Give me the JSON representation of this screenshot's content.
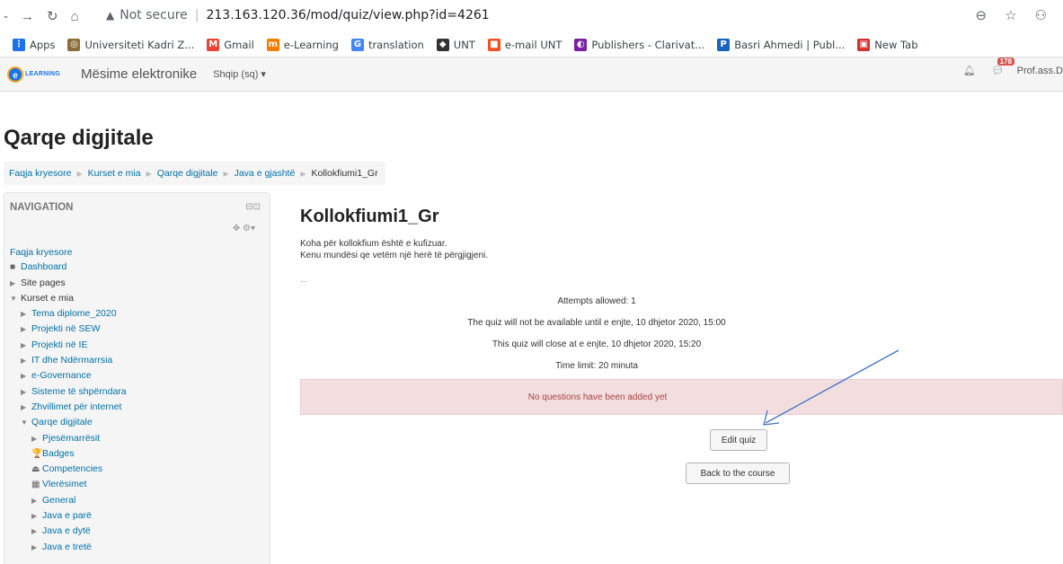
{
  "browser": {
    "security_text": "Not secure",
    "url": "213.163.120.36/mod/quiz/view.php?id=4261"
  },
  "bookmarks": [
    {
      "label": "Apps",
      "color": "#1a73e8",
      "glyph": "⋮"
    },
    {
      "label": "Universiteti Kadri Z...",
      "color": "#8a6d3b",
      "glyph": "◎"
    },
    {
      "label": "Gmail",
      "color": "#ea4335",
      "glyph": "M"
    },
    {
      "label": "e-Learning",
      "color": "#f57c00",
      "glyph": "m"
    },
    {
      "label": "translation",
      "color": "#4285f4",
      "glyph": "G"
    },
    {
      "label": "UNT",
      "color": "#333333",
      "glyph": "◆"
    },
    {
      "label": "e-mail UNT",
      "color": "#f25022",
      "glyph": "■"
    },
    {
      "label": "Publishers - Clarivat...",
      "color": "#7b1fa2",
      "glyph": "◐"
    },
    {
      "label": "Basri Ahmedi | Publ...",
      "color": "#1565c0",
      "glyph": "P"
    },
    {
      "label": "New Tab",
      "color": "#d32f2f",
      "glyph": "▣"
    }
  ],
  "navbar": {
    "logo_text": "LEARNING",
    "brand": "Mësime elektronike",
    "language": "Shqip (sq) ▾",
    "messages_count": "178",
    "user": "Prof.ass.D"
  },
  "page": {
    "heading": "Qarqe digjitale",
    "breadcrumb": [
      "Faqja kryesore",
      "Kurset e mia",
      "Qarqe digjitale",
      "Java e gjashtë",
      "Kollokfiumi1_Gr"
    ]
  },
  "sidebar": {
    "title": "NAVIGATION",
    "items": [
      {
        "label": "Faqja kryesore",
        "type": "link",
        "indent": 0,
        "marker": ""
      },
      {
        "label": "Dashboard",
        "type": "link",
        "indent": 0,
        "marker": "■"
      },
      {
        "label": "Site pages",
        "type": "plain",
        "indent": 0,
        "marker": "▶"
      },
      {
        "label": "Kurset e mia",
        "type": "plain",
        "indent": 0,
        "marker": "▼"
      },
      {
        "label": "Tema diplome_2020",
        "type": "link",
        "indent": 1,
        "marker": "▶"
      },
      {
        "label": "Projekti në SEW",
        "type": "link",
        "indent": 1,
        "marker": "▶"
      },
      {
        "label": "Projekti në IE",
        "type": "link",
        "indent": 1,
        "marker": "▶"
      },
      {
        "label": "IT dhe Ndërmarrsia",
        "type": "link",
        "indent": 1,
        "marker": "▶"
      },
      {
        "label": "e-Governance",
        "type": "link",
        "indent": 1,
        "marker": "▶"
      },
      {
        "label": "Sisteme të shpërndara",
        "type": "link",
        "indent": 1,
        "marker": "▶"
      },
      {
        "label": "Zhvillimet për internet",
        "type": "link",
        "indent": 1,
        "marker": "▶"
      },
      {
        "label": "Qarqe digjitale",
        "type": "link",
        "indent": 1,
        "marker": "▼"
      },
      {
        "label": "Pjesëmarrësit",
        "type": "link",
        "indent": 2,
        "marker": "▶"
      },
      {
        "label": "Badges",
        "type": "link",
        "indent": 2,
        "marker": "🏆"
      },
      {
        "label": "Competencies",
        "type": "link",
        "indent": 2,
        "marker": "⏏"
      },
      {
        "label": "Vlerësimet",
        "type": "link",
        "indent": 2,
        "marker": "▦"
      },
      {
        "label": "General",
        "type": "link",
        "indent": 2,
        "marker": "▶"
      },
      {
        "label": "Java e parë",
        "type": "link",
        "indent": 2,
        "marker": "▶"
      },
      {
        "label": "Java e dytë",
        "type": "link",
        "indent": 2,
        "marker": "▶"
      },
      {
        "label": "Java e tretë",
        "type": "link",
        "indent": 2,
        "marker": "▶"
      }
    ]
  },
  "quiz": {
    "title": "Kollokfiumi1_Gr",
    "intro_line1": "Koha për kollokfium është e kufizuar.",
    "intro_line2": "Kenu mundësi qe vetëm një herë të përgjigjeni.",
    "dots": "...",
    "attempts": "Attempts allowed: 1",
    "open_info": "The quiz will not be available until e enjte, 10 dhjetor 2020, 15:00",
    "close_info": "This quiz will close at e enjte, 10 dhjetor 2020, 15:20",
    "time_limit": "Time limit: 20 minuta",
    "no_questions": "No questions have been added yet",
    "edit_button": "Edit quiz",
    "back_button": "Back to the course"
  }
}
